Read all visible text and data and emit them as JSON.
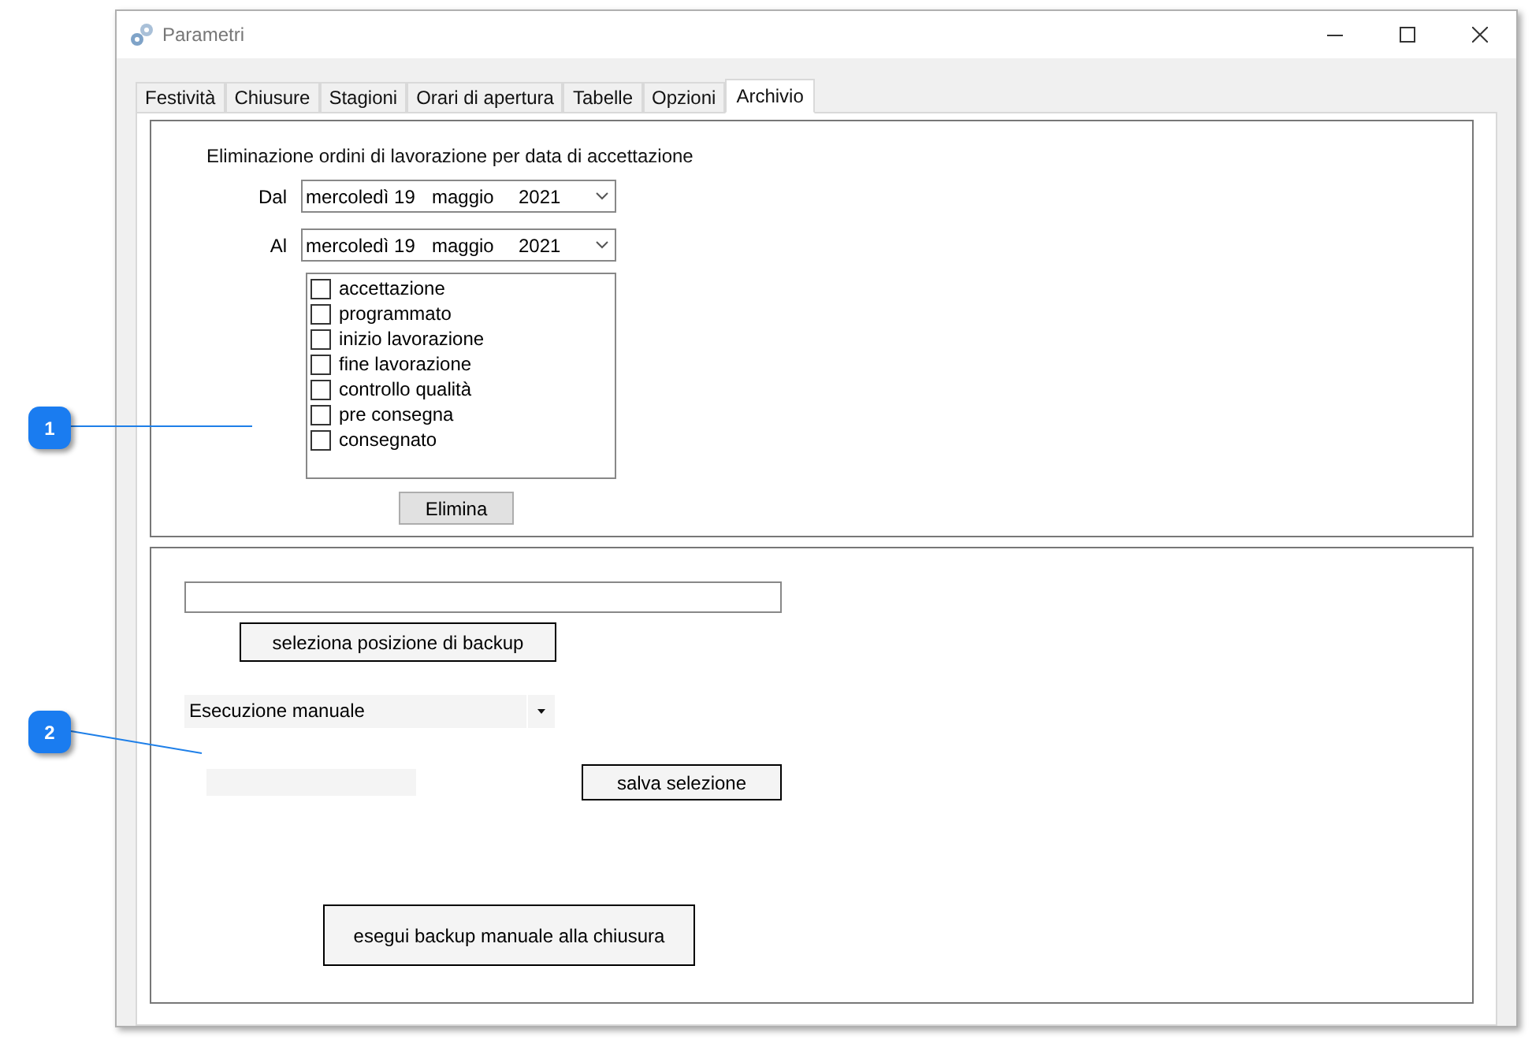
{
  "window": {
    "title": "Parametri"
  },
  "tabs": [
    {
      "label": "Festività",
      "selected": false
    },
    {
      "label": "Chiusure",
      "selected": false
    },
    {
      "label": "Stagioni",
      "selected": false
    },
    {
      "label": "Orari di apertura",
      "selected": false
    },
    {
      "label": "Tabelle",
      "selected": false
    },
    {
      "label": "Opzioni",
      "selected": false
    },
    {
      "label": "Archivio",
      "selected": true
    }
  ],
  "deletion": {
    "title": "Eliminazione ordini di lavorazione per data di accettazione",
    "dates": [
      {
        "label": "Dal",
        "day": "mercoledì 19",
        "month": "maggio",
        "year": "2021"
      },
      {
        "label": "Al",
        "day": "mercoledì 19",
        "month": "maggio",
        "year": "2021"
      }
    ],
    "statuses": [
      {
        "label": "accettazione",
        "checked": false
      },
      {
        "label": "programmato",
        "checked": false
      },
      {
        "label": "inizio lavorazione",
        "checked": false
      },
      {
        "label": "fine lavorazione",
        "checked": false
      },
      {
        "label": "controllo qualità",
        "checked": false
      },
      {
        "label": "pre consegna",
        "checked": false
      },
      {
        "label": "consegnato",
        "checked": false
      }
    ],
    "delete_button": "Elimina"
  },
  "backup": {
    "select_location_button": "seleziona posizione di backup",
    "mode_dropdown": {
      "value": "Esecuzione manuale"
    },
    "save_selection_button": "salva selezione",
    "manual_backup_button": "esegui backup manuale alla chiusura"
  },
  "callouts": [
    {
      "label": "1"
    },
    {
      "label": "2"
    }
  ]
}
